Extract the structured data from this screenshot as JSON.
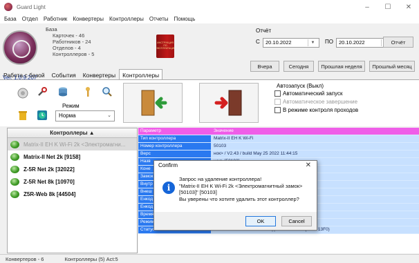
{
  "window": {
    "title": "Guard Light",
    "minimize": "–",
    "maximize": "☐",
    "close": "✕"
  },
  "menu": [
    "База",
    "Отдел",
    "Работник",
    "Конвертеры",
    "Контроллеры",
    "Отчеты",
    "Помощь"
  ],
  "db": {
    "heading": "База",
    "stats": [
      "Карточек - 46",
      "Работников - 24",
      "Отделов - 4",
      "Контроллеров - 5"
    ],
    "version": "Ver. 1.0.9.207"
  },
  "book_text": "ИНСТРУКЦИЯ ПО ЭКСПЛУАТАЦИИ",
  "report": {
    "heading": "Отчёт",
    "from_label": "С",
    "from_date": "20.10.2022",
    "to_label": "ПО",
    "to_date": "20.10.2022",
    "dropdown": "▼",
    "report_btn": "Отчёт",
    "buttons": [
      "Вчера",
      "Сегодня",
      "Прошлая неделя",
      "Прошлый месяц"
    ]
  },
  "tabs": [
    "Работа с базой",
    "События",
    "Конвертеры",
    "Контроллеры"
  ],
  "active_tab_index": 3,
  "toolbar": {
    "mode_label": "Режим",
    "mode_value": "Норма",
    "mode_arrow": "⌄"
  },
  "autostart": {
    "title": "Автозапуск (Выкл)",
    "options": [
      {
        "label": "Автоматический запуск",
        "enabled": true
      },
      {
        "label": "Автоматическое завершение",
        "enabled": false
      },
      {
        "label": "В режиме контроля проходов",
        "enabled": true
      }
    ]
  },
  "controllers": {
    "header": "Контроллеры ▲",
    "items": [
      {
        "label": "Matrix-II EH K Wi-Fi 2k <Электромагни...",
        "selected": true
      },
      {
        "label": "Matrix-II Net 2k [9158]",
        "selected": false
      },
      {
        "label": "Z-5R Net 2k  [32022]",
        "selected": false
      },
      {
        "label": "Z-5R Net 8k [10970]",
        "selected": false
      },
      {
        "label": "Z5R-Web 8k  [44504]",
        "selected": false
      }
    ]
  },
  "grid": {
    "header": {
      "param": "Параметр",
      "value": "Значение"
    },
    "rows": [
      {
        "param": "Тип контроллера",
        "value": "Matrix-II EH K Wi-Fi"
      },
      {
        "param": "Номер контроллера",
        "value": "50103"
      },
      {
        "param": "Верс",
        "value": "                                                          нок> / V2.43 / build May 25 2022 11:44:15"
      },
      {
        "param": "Назв",
        "value": "                                                          нок> [50103]"
      },
      {
        "param": "Коне",
        "value": "                                                          28:1000\""
      },
      {
        "param": "Замок",
        "value": "                                                          крытия - нет. Контроль закрытия - нет."
      },
      {
        "param": "Внутр",
        "value": ""
      },
      {
        "param": "Внеш",
        "value": ""
      },
      {
        "param": "Енкод",
        "value": ""
      },
      {
        "param": "Енкод",
        "value": ""
      },
      {
        "param": "Время",
        "value": ""
      },
      {
        "param": "Режим/замок/дверь",
        "value": "[Норма] Всё в исходном"
      },
      {
        "param": "Статус",
        "value": "Пт 21-10-2022 13:13:56 Ожидание событий (13F0 13F0)"
      }
    ]
  },
  "dialog": {
    "title": "Confirm",
    "close": "✕",
    "icon": "i",
    "line1": "Запрос на удаление контроллера!",
    "line2": "\"Matrix-II EH K Wi-Fi 2k <Электромагнитный замок>",
    "line3": "[50103]\" [50103]",
    "line4": "Вы уверены что хотите удалить этот контроллер?",
    "ok": "OK",
    "cancel": "Cancel"
  },
  "status": {
    "converters": "Конвертеров - 6",
    "controllers": "Контроллеры (5) Act:5"
  }
}
